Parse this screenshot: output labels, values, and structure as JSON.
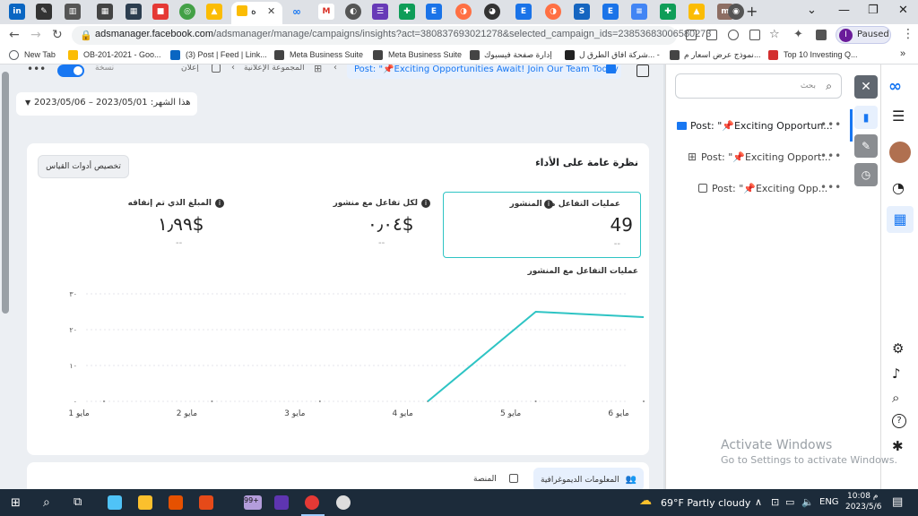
{
  "browser": {
    "tab_strip": {
      "active_tab_label": "ه",
      "new_tab_symbol": "+",
      "close_symbol": "✕"
    },
    "address_bar": {
      "url_host": "adsmanager.facebook.com",
      "url_rest": "/adsmanager/manage/campaigns/insights?act=380837693021278&selected_campaign_ids=23853683006580273",
      "profile_initial": "I",
      "profile_status": "Paused"
    },
    "bookmarks": [
      {
        "label": "New Tab",
        "color": "#5f6368"
      },
      {
        "label": "OB-201-2021 - Goo...",
        "color": "#fbbc04"
      },
      {
        "label": "(3) Post | Feed | Link...",
        "color": "#0a66c2"
      },
      {
        "label": "Meta Business Suite",
        "color": "#444"
      },
      {
        "label": "Meta Business Suite",
        "color": "#444"
      },
      {
        "label": "إدارة صفحة فيسبوك",
        "color": "#444"
      },
      {
        "label": "شركة افاق الطرق ل... -",
        "color": "#444"
      },
      {
        "label": "نموذج عرض اسعار م...",
        "color": "#444"
      },
      {
        "label": "Top 10 Investing Q...",
        "color": "#d32f2f"
      }
    ],
    "bookmarks_overflow": "»"
  },
  "breadcrumb": {
    "post_label": "Post: \"📌Exciting Opportunities Await! Join Our Team Today",
    "adset_label": "المجموعة الإعلانية",
    "ad_label": "إعلان",
    "scope_label": "نسخة"
  },
  "date_range": {
    "label": "هذا الشهر: 2023/05/01 – 2023/05/06"
  },
  "overview": {
    "title": "نظرة عامة على الأداء",
    "customize_button": "تخصيص أدوات القياس",
    "metrics": [
      {
        "label": "عمليات التفاعل مع المنشور",
        "value": "49",
        "compare": "--",
        "selected": true
      },
      {
        "label": "لكل تفاعل مع منشور",
        "value": "٠٫٠٤$",
        "compare": "--",
        "selected": false
      },
      {
        "label": "المبلغ الذي تم إنفاقه",
        "value": "١٫٩٩$",
        "compare": "--",
        "selected": false
      }
    ],
    "info_icon": "i"
  },
  "chart_data": {
    "type": "line",
    "title": "عمليات التفاعل مع المنشور",
    "x": [
      "1 مايو",
      "2 مايو",
      "3 مايو",
      "4 مايو",
      "5 مايو",
      "6 مايو"
    ],
    "series": [
      {
        "values": [
          null,
          null,
          null,
          0,
          25,
          23.5
        ]
      }
    ],
    "ylim": [
      0,
      30
    ],
    "y_ticks": [
      "٣٠",
      "٢٠",
      "١٠",
      "٠"
    ],
    "grid": true,
    "line_color": "#2ec4c4"
  },
  "bottom_tabs": [
    {
      "label": "المعلومات الديموغرافية",
      "active": true
    },
    {
      "label": "المنصة",
      "active": false
    }
  ],
  "right_panel": {
    "search_placeholder": "بحث",
    "items": [
      {
        "label": "Post: \"📌Exciting Opportun...",
        "level": "campaign",
        "selected": true
      },
      {
        "label": "Post: \"📌Exciting Opport...",
        "level": "adset",
        "selected": false
      },
      {
        "label": "Post: \"📌Exciting Opp...",
        "level": "ad",
        "selected": false
      }
    ],
    "more": "•••"
  },
  "watermark": {
    "line1": "Activate Windows",
    "line2": "Go to Settings to activate Windows."
  },
  "taskbar": {
    "weather": "69°F  Partly cloudy",
    "lang": "ENG",
    "time": "10:08 م",
    "date": "2023/5/6",
    "notification_badge": "99+"
  }
}
